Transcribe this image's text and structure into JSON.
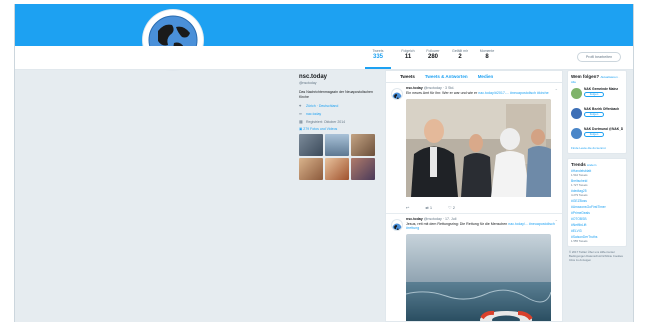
{
  "profile": {
    "name": "nsc.today",
    "handle": "@nsctoday",
    "bio": "Das Nachrichtenmagazin der Neuapostolischen Kirche",
    "location": "Zürich · Deutschland",
    "website": "nac.today",
    "joined": "Registriert: Oktober 2014",
    "media_link": "279 Fotos und Videos"
  },
  "stats": [
    {
      "label": "Tweets",
      "value": "335"
    },
    {
      "label": "Folgeich",
      "value": "11"
    },
    {
      "label": "Follower",
      "value": "280"
    },
    {
      "label": "Gefällt mir",
      "value": "2"
    },
    {
      "label": "Momente",
      "value": "8"
    }
  ],
  "edit_button": "Profil bearbeiten",
  "timeline": {
    "tabs": [
      "Tweets",
      "Tweets & Antworten",
      "Medien"
    ],
    "tweets": [
      {
        "name": "nsc.today",
        "meta": "@nsctoday · 3 Std.",
        "text": "Ein neues Amt für ihn: Wer er war und wie er",
        "link_text": "nac.today/#2017-... #neuapostolisch #kirche",
        "actions": [
          "↩",
          "⇄ 1",
          "♡ 2"
        ]
      },
      {
        "name": "nsc.today",
        "meta": "@nsctoday · 17. Juli",
        "text": "Jesus, rett mit dem Rettungsring: Die Rettung für die Menschen",
        "link_text": "nac.today/... #neuapostolisch #rettung",
        "actions": []
      }
    ]
  },
  "sidebar": {
    "who_to_follow": {
      "title": "Wem folgen?",
      "subtitle": "Aktualisieren · Alle",
      "accounts": [
        {
          "name": "NAK Gemeinde Mainz",
          "button": "Folgen"
        },
        {
          "name": "NAK Bezirk Offenbach",
          "button": "Folgen"
        },
        {
          "name": "NAK Dortmund @NAK_Dortm",
          "button": "Folgen"
        }
      ],
      "find_link": "Finde Leute die du kennst"
    },
    "trends": {
      "title": "Trends",
      "subtitle": "ändern",
      "items": [
        {
          "tag": "#Handelsblatt",
          "count": "1.542 Tweets"
        },
        {
          "tag": "Breitscheid",
          "count": "1.727 Tweets"
        },
        {
          "tag": "#dedtag25",
          "count": "4.279 Tweets"
        },
        {
          "tag": "#GEZBoss",
          "count": ""
        },
        {
          "tag": "#AmazonsGoFirstTimer",
          "count": ""
        },
        {
          "tag": "#PrimeDeals",
          "count": ""
        },
        {
          "tag": "#OTOBSB",
          "count": ""
        },
        {
          "tag": "#NetflixLift",
          "count": ""
        },
        {
          "tag": "#ELVI3",
          "count": ""
        },
        {
          "tag": "#SaisonDerTruths",
          "count": "1.555 Tweets"
        }
      ]
    },
    "footer": "© 2017 Twitter  Über uns  Hilfe-Center  Bedingungen  Datenschutzrichtlinie  Cookies  Infos zu Anzeigen"
  },
  "colors": {
    "accent": "#1da1f2",
    "background": "#e6ecf0"
  }
}
